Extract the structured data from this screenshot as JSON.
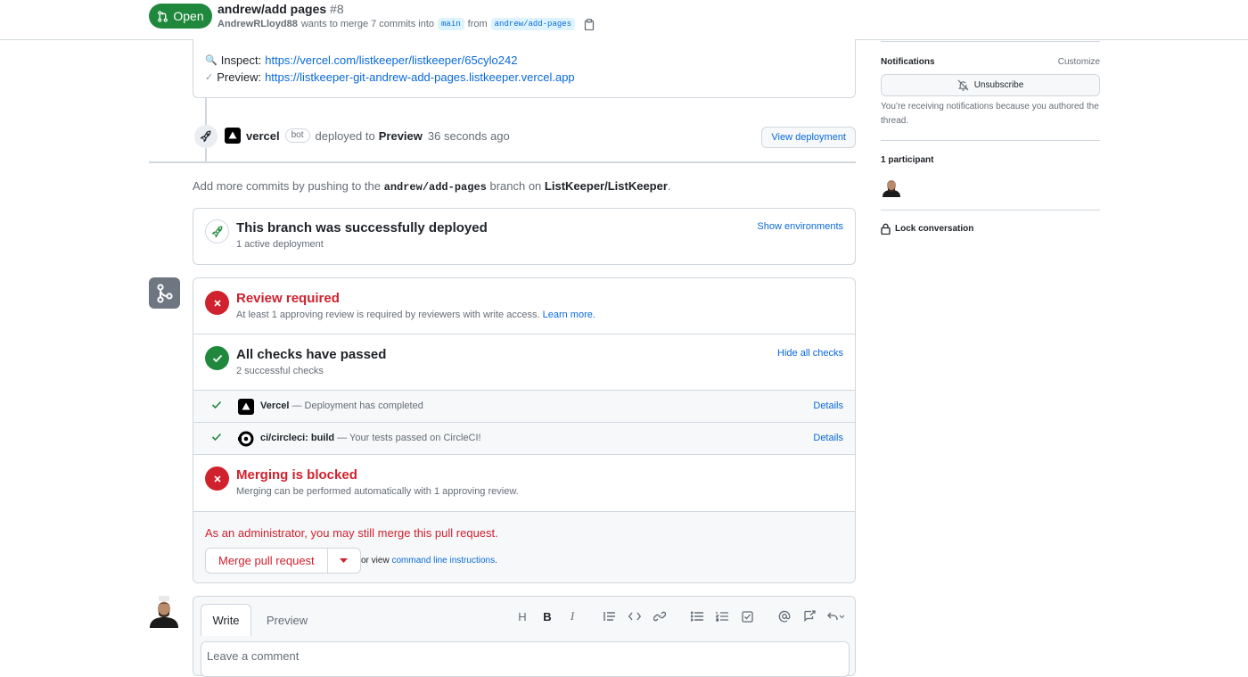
{
  "header": {
    "state": "Open",
    "title": "andrew/add pages",
    "number": "#8",
    "author": "AndrewRLloyd88",
    "merge_text": "wants to merge 7 commits into",
    "base_branch": "main",
    "from_text": "from",
    "head_branch": "andrew/add-pages"
  },
  "deploy_card": {
    "inspect_label": "Inspect:",
    "inspect_url": "https://vercel.com/listkeeper/listkeeper/65cylo242",
    "preview_label": "Preview:",
    "preview_url": "https://listkeeper-git-andrew-add-pages.listkeeper.vercel.app"
  },
  "deploy_event": {
    "actor": "vercel",
    "bot_label": "bot",
    "action": "deployed to",
    "environment": "Preview",
    "time": "36 seconds ago",
    "button": "View deployment"
  },
  "push_hint": {
    "prefix": "Add more commits by pushing to the",
    "branch": "andrew/add-pages",
    "middle": "branch on",
    "repo": "ListKeeper/ListKeeper",
    "suffix": "."
  },
  "deployed_box": {
    "title": "This branch was successfully deployed",
    "subtitle": "1 active deployment",
    "link": "Show environments"
  },
  "merge_box": {
    "review": {
      "title": "Review required",
      "subtitle": "At least 1 approving review is required by reviewers with write access.",
      "link": "Learn more."
    },
    "checks": {
      "title": "All checks have passed",
      "subtitle": "2 successful checks",
      "link": "Hide all checks",
      "items": [
        {
          "name": "Vercel",
          "desc": "— Deployment has completed",
          "details": "Details"
        },
        {
          "name": "ci/circleci: build",
          "desc": "— Your tests passed on CircleCI!",
          "details": "Details"
        }
      ]
    },
    "blocked": {
      "title": "Merging is blocked",
      "subtitle": "Merging can be performed automatically with 1 approving review."
    },
    "admin_note": "As an administrator, you may still merge this pull request.",
    "merge_button": "Merge pull request",
    "cli_prefix": "or view",
    "cli_link": "command line instructions",
    "cli_suffix": "."
  },
  "composer": {
    "tab_write": "Write",
    "tab_preview": "Preview",
    "placeholder": "Leave a comment",
    "tools": [
      "H",
      "B",
      "I"
    ]
  },
  "sidebar": {
    "notifications_heading": "Notifications",
    "customize": "Customize",
    "unsubscribe": "Unsubscribe",
    "notif_reason": "You’re receiving notifications because you authored the thread.",
    "participants_heading": "1 participant",
    "lock": "Lock conversation"
  },
  "colors": {
    "accent": "#0969da",
    "success": "#1f883d",
    "danger": "#cf222e",
    "muted": "#656d76",
    "border": "#d0d7de"
  }
}
